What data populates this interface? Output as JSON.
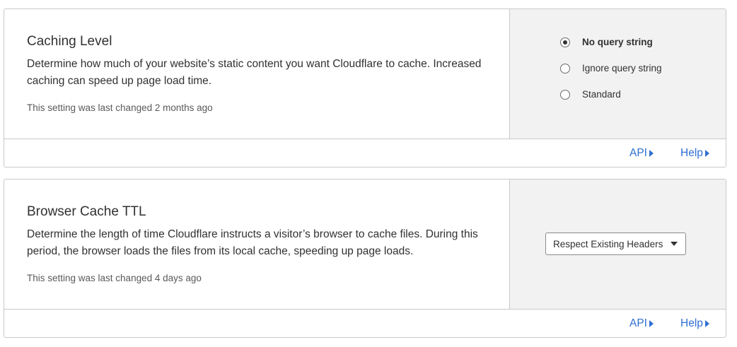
{
  "caching_level": {
    "title": "Caching Level",
    "description": "Determine how much of your website’s static content you want Cloudflare to cache. Increased caching can speed up page load time.",
    "last_changed": "This setting was last changed 2 months ago",
    "options": [
      {
        "label": "No query string",
        "checked": true
      },
      {
        "label": "Ignore query string",
        "checked": false
      },
      {
        "label": "Standard",
        "checked": false
      }
    ],
    "api_label": "API",
    "help_label": "Help"
  },
  "browser_cache_ttl": {
    "title": "Browser Cache TTL",
    "description": "Determine the length of time Cloudflare instructs a visitor’s browser to cache files. During this period, the browser loads the files from its local cache, speeding up page loads.",
    "last_changed": "This setting was last changed 4 days ago",
    "selected_value": "Respect Existing Headers",
    "api_label": "API",
    "help_label": "Help"
  },
  "colors": {
    "link": "#2f6fd1",
    "control_panel_bg": "#f2f2f2",
    "border": "#c9c9c9"
  }
}
